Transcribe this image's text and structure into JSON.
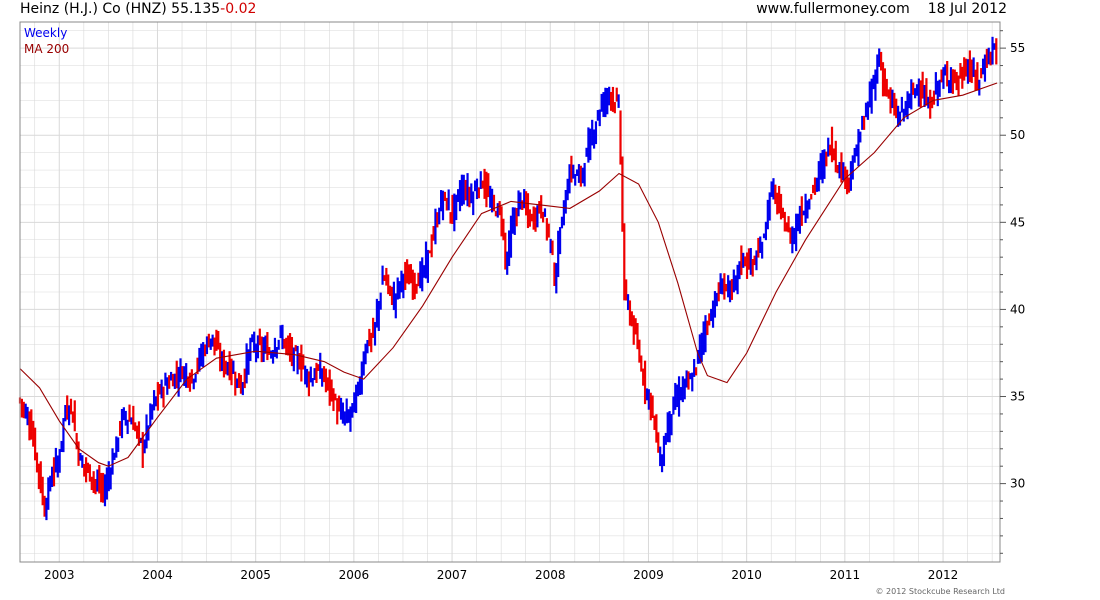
{
  "header": {
    "company": "Heinz (H.J.) Co",
    "ticker": "(HNZ)",
    "price": "55.135",
    "change": "-0.02",
    "site": "www.fullermoney.com",
    "date": "18 Jul 2012"
  },
  "footer": {
    "copyright": "© 2012 Stockcube Research Ltd"
  },
  "colors": {
    "up": "#0000ee",
    "down": "#ee0000",
    "ma": "#990000",
    "grid": "#d9d9d9"
  },
  "chart_data": {
    "type": "line",
    "title": "Heinz (H.J.) Co (HNZ) 55.135 -0.02",
    "xlabel": "",
    "ylabel": "",
    "legend": [
      "Weekly",
      "MA 200"
    ],
    "legend_position": "top-left",
    "grid": true,
    "x_range": [
      2002.6,
      2012.58
    ],
    "ylim": [
      25.5,
      56.5
    ],
    "x_ticks": [
      "2003",
      "2004",
      "2005",
      "2006",
      "2007",
      "2008",
      "2009",
      "2010",
      "2011",
      "2012"
    ],
    "y_ticks": [
      30,
      35,
      40,
      45,
      50,
      55
    ],
    "y_axis_side": "right",
    "series": [
      {
        "name": "Weekly",
        "style": "ohlc-bars",
        "x": [
          2002.6,
          2002.7,
          2002.78,
          2002.85,
          2002.92,
          2003.0,
          2003.05,
          2003.12,
          2003.2,
          2003.28,
          2003.38,
          2003.45,
          2003.55,
          2003.65,
          2003.75,
          2003.85,
          2003.95,
          2004.05,
          2004.15,
          2004.25,
          2004.35,
          2004.45,
          2004.55,
          2004.65,
          2004.75,
          2004.85,
          2004.95,
          2005.05,
          2005.15,
          2005.25,
          2005.35,
          2005.45,
          2005.55,
          2005.65,
          2005.75,
          2005.85,
          2005.95,
          2006.05,
          2006.12,
          2006.2,
          2006.3,
          2006.4,
          2006.5,
          2006.6,
          2006.7,
          2006.8,
          2006.9,
          2007.0,
          2007.1,
          2007.2,
          2007.3,
          2007.4,
          2007.5,
          2007.55,
          2007.6,
          2007.7,
          2007.8,
          2007.9,
          2008.0,
          2008.05,
          2008.1,
          2008.2,
          2008.3,
          2008.4,
          2008.5,
          2008.6,
          2008.7,
          2008.72,
          2008.75,
          2008.8,
          2008.88,
          2008.95,
          2009.05,
          2009.12,
          2009.18,
          2009.25,
          2009.35,
          2009.45,
          2009.55,
          2009.65,
          2009.75,
          2009.85,
          2009.95,
          2010.05,
          2010.15,
          2010.25,
          2010.35,
          2010.45,
          2010.55,
          2010.65,
          2010.75,
          2010.85,
          2010.95,
          2011.05,
          2011.15,
          2011.25,
          2011.35,
          2011.38,
          2011.45,
          2011.55,
          2011.65,
          2011.75,
          2011.85,
          2011.95,
          2012.05,
          2012.15,
          2012.25,
          2012.35,
          2012.45,
          2012.55
        ],
        "y": [
          34.8,
          33.5,
          31.0,
          28.5,
          30.5,
          31.5,
          34.0,
          34.5,
          31.5,
          30.8,
          30.0,
          29.5,
          31.5,
          34.0,
          33.5,
          32.0,
          34.5,
          35.5,
          36.0,
          36.5,
          36.0,
          37.5,
          38.5,
          37.0,
          36.5,
          35.5,
          38.0,
          37.8,
          37.5,
          38.5,
          37.5,
          37.0,
          36.0,
          36.5,
          35.5,
          34.0,
          33.8,
          35.5,
          38.0,
          38.5,
          42.0,
          40.5,
          42.0,
          41.5,
          42.0,
          44.0,
          46.5,
          45.5,
          47.0,
          46.5,
          47.5,
          46.0,
          45.5,
          42.5,
          44.5,
          46.5,
          45.0,
          46.0,
          44.0,
          41.5,
          44.5,
          48.0,
          47.5,
          49.5,
          51.5,
          52.5,
          51.5,
          48.0,
          41.0,
          40.0,
          38.0,
          36.0,
          34.0,
          31.0,
          33.0,
          34.5,
          35.5,
          36.0,
          38.5,
          40.0,
          41.5,
          41.0,
          43.0,
          42.5,
          43.5,
          47.0,
          45.5,
          44.0,
          45.5,
          46.5,
          48.0,
          49.5,
          48.0,
          47.5,
          50.0,
          52.0,
          54.5,
          53.5,
          52.0,
          51.0,
          52.0,
          53.0,
          51.5,
          53.0,
          53.5,
          53.0,
          54.0,
          53.0,
          54.5,
          55.135
        ]
      },
      {
        "name": "MA 200",
        "style": "line",
        "x": [
          2002.6,
          2002.8,
          2003.0,
          2003.2,
          2003.4,
          2003.5,
          2003.7,
          2004.0,
          2004.3,
          2004.6,
          2005.0,
          2005.4,
          2005.7,
          2005.9,
          2006.1,
          2006.4,
          2006.7,
          2007.0,
          2007.3,
          2007.6,
          2007.9,
          2008.2,
          2008.5,
          2008.7,
          2008.9,
          2009.1,
          2009.3,
          2009.5,
          2009.6,
          2009.8,
          2010.0,
          2010.3,
          2010.6,
          2011.0,
          2011.3,
          2011.6,
          2011.9,
          2012.2,
          2012.55
        ],
        "y": [
          36.6,
          35.5,
          33.6,
          32.0,
          31.2,
          31.0,
          31.5,
          33.8,
          36.0,
          37.2,
          37.6,
          37.4,
          37.0,
          36.4,
          36.0,
          37.8,
          40.2,
          43.0,
          45.5,
          46.2,
          46.0,
          45.8,
          46.8,
          47.8,
          47.2,
          45.0,
          41.5,
          37.5,
          36.2,
          35.8,
          37.5,
          41.0,
          44.0,
          47.5,
          49.0,
          51.0,
          52.0,
          52.3,
          53.0
        ]
      }
    ]
  }
}
